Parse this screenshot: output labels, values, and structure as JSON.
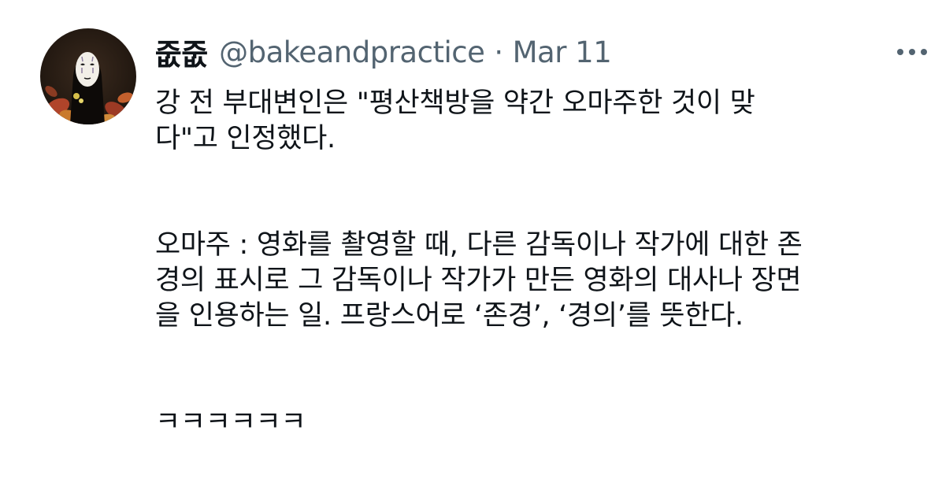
{
  "tweet": {
    "author": {
      "display_name": "줎줎",
      "handle": "@bakeandpractice",
      "avatar_icon": "no-face-avatar-icon"
    },
    "separator": "·",
    "date": "Mar 11",
    "more_icon": "more-horizontal-icon",
    "body": {
      "paragraph_1": "강 전 부대변인은 \"평산책방을 약간 오마주한 것이 맞\n다\"고 인정했다.",
      "paragraph_2": "오마주 : 영화를 촬영할 때, 다른 감독이나 작가에 대한 존\n경의 표시로 그 감독이나 작가가 만든 영화의 대사나 장면\n을 인용하는 일. 프랑스어로 ‘존경’, ‘경의’를 뜻한다.",
      "paragraph_3": "ㅋㅋㅋㅋㅋㅋ"
    }
  },
  "colors": {
    "text_primary": "#0f1419",
    "text_secondary": "#536471",
    "background": "#ffffff"
  }
}
